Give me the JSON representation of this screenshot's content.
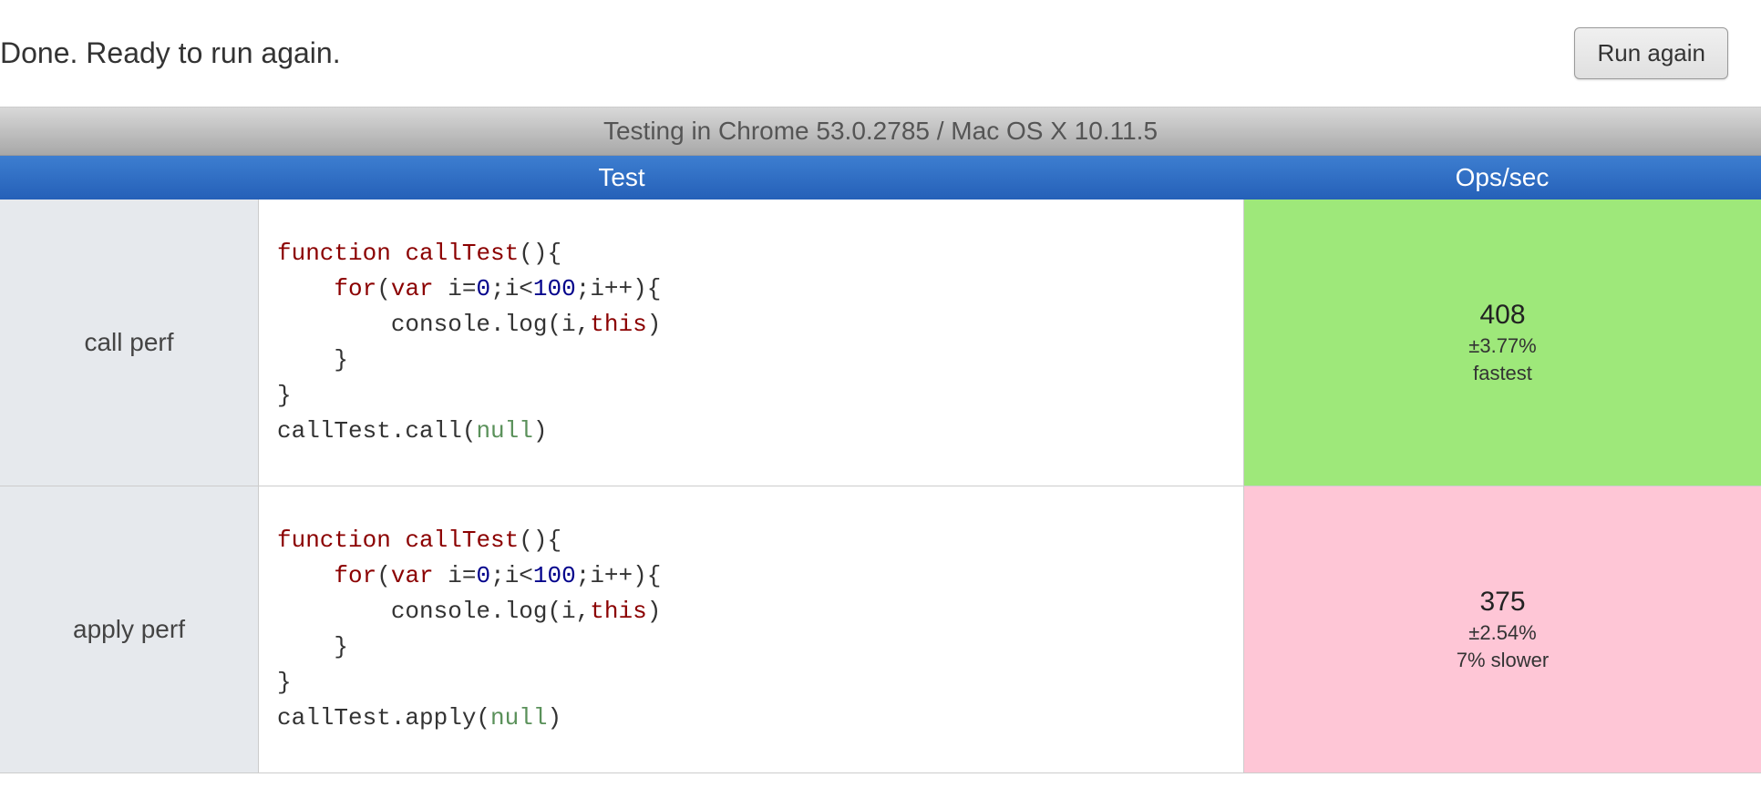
{
  "status": "Done. Ready to run again.",
  "runButton": "Run again",
  "environment": "Testing in Chrome 53.0.2785 / Mac OS X 10.11.5",
  "headers": {
    "test": "Test",
    "ops": "Ops/sec"
  },
  "rows": [
    {
      "name": "call perf",
      "code": {
        "tokens": [
          {
            "t": "function ",
            "c": "kw"
          },
          {
            "t": "callTest",
            "c": "fn-name"
          },
          {
            "t": "(){",
            "c": ""
          },
          {
            "t": "\n    ",
            "c": ""
          },
          {
            "t": "for",
            "c": "kw"
          },
          {
            "t": "(",
            "c": ""
          },
          {
            "t": "var ",
            "c": "kw"
          },
          {
            "t": "i=",
            "c": ""
          },
          {
            "t": "0",
            "c": "num"
          },
          {
            "t": ";i<",
            "c": ""
          },
          {
            "t": "100",
            "c": "num"
          },
          {
            "t": ";i++){",
            "c": ""
          },
          {
            "t": "\n        console.log(i,",
            "c": ""
          },
          {
            "t": "this",
            "c": "kw"
          },
          {
            "t": ")",
            "c": ""
          },
          {
            "t": "\n    }",
            "c": ""
          },
          {
            "t": "\n}",
            "c": ""
          },
          {
            "t": "\ncallTest.call(",
            "c": ""
          },
          {
            "t": "null",
            "c": "lit"
          },
          {
            "t": ")",
            "c": ""
          }
        ]
      },
      "ops": "408",
      "variance": "±3.77%",
      "rank": "fastest",
      "rankClass": "fastest"
    },
    {
      "name": "apply perf",
      "code": {
        "tokens": [
          {
            "t": "function ",
            "c": "kw"
          },
          {
            "t": "callTest",
            "c": "fn-name"
          },
          {
            "t": "(){",
            "c": ""
          },
          {
            "t": "\n    ",
            "c": ""
          },
          {
            "t": "for",
            "c": "kw"
          },
          {
            "t": "(",
            "c": ""
          },
          {
            "t": "var ",
            "c": "kw"
          },
          {
            "t": "i=",
            "c": ""
          },
          {
            "t": "0",
            "c": "num"
          },
          {
            "t": ";i<",
            "c": ""
          },
          {
            "t": "100",
            "c": "num"
          },
          {
            "t": ";i++){",
            "c": ""
          },
          {
            "t": "\n        console.log(i,",
            "c": ""
          },
          {
            "t": "this",
            "c": "kw"
          },
          {
            "t": ")",
            "c": ""
          },
          {
            "t": "\n    }",
            "c": ""
          },
          {
            "t": "\n}",
            "c": ""
          },
          {
            "t": "\ncallTest.apply(",
            "c": ""
          },
          {
            "t": "null",
            "c": "lit"
          },
          {
            "t": ")",
            "c": ""
          }
        ]
      },
      "ops": "375",
      "variance": "±2.54%",
      "rank": "7% slower",
      "rankClass": "slower"
    }
  ]
}
